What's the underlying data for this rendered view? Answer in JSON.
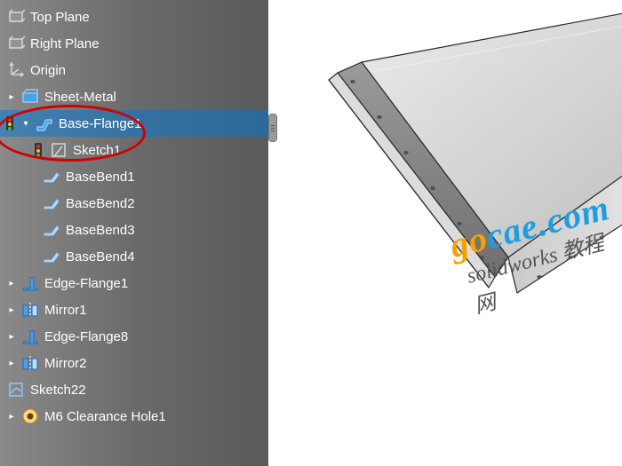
{
  "tree": {
    "topPlane": "Top Plane",
    "rightPlane": "Right Plane",
    "origin": "Origin",
    "sheetMetal": "Sheet-Metal",
    "baseFlange1": "Base-Flange1",
    "sketch1": "Sketch1",
    "baseBend1": "BaseBend1",
    "baseBend2": "BaseBend2",
    "baseBend3": "BaseBend3",
    "baseBend4": "BaseBend4",
    "edgeFlange1": "Edge-Flange1",
    "mirror1": "Mirror1",
    "edgeFlange8": "Edge-Flange8",
    "mirror2": "Mirror2",
    "sketch22": "Sketch22",
    "m6Hole": "M6 Clearance Hole1"
  },
  "watermark": {
    "brand_pre": "go",
    "brand_suf": "cae.com",
    "subtitle": "solidworks 教程网"
  }
}
